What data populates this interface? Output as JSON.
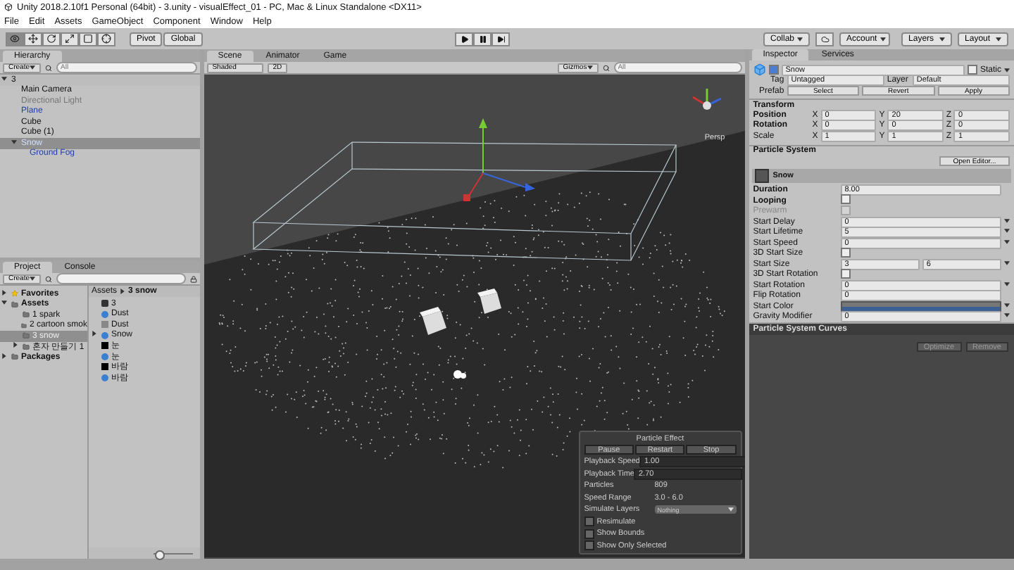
{
  "window": {
    "title": "Unity 2018.2.10f1 Personal (64bit) - 3.unity - visualEffect_01 - PC, Mac & Linux Standalone <DX11>"
  },
  "menu": [
    "File",
    "Edit",
    "Assets",
    "GameObject",
    "Component",
    "Window",
    "Help"
  ],
  "toolbar": {
    "tools": [
      {
        "kind": "view",
        "selected": true
      },
      {
        "kind": "move",
        "selected": false
      },
      {
        "kind": "rotate",
        "selected": false
      },
      {
        "kind": "scale",
        "selected": false
      },
      {
        "kind": "rect",
        "selected": false
      },
      {
        "kind": "transform",
        "selected": false
      }
    ],
    "pivot": "Pivot",
    "global": "Global",
    "collab": "Collab",
    "account": "Account",
    "layers": "Layers",
    "layout": "Layout"
  },
  "hierarchy": {
    "tab": "Hierarchy",
    "create": "Create",
    "placeholder": "All",
    "scene": "3",
    "items": [
      {
        "name": "Main Camera",
        "prefab": false,
        "active": true,
        "selected": false
      },
      {
        "name": "Directional Light",
        "prefab": false,
        "active": false,
        "selected": false
      },
      {
        "name": "Plane",
        "prefab": true,
        "active": true,
        "selected": false
      },
      {
        "name": "Cube",
        "prefab": false,
        "active": true,
        "selected": false
      },
      {
        "name": "Cube (1)",
        "prefab": false,
        "active": true,
        "selected": false
      },
      {
        "name": "Snow",
        "prefab": true,
        "active": true,
        "selected": true,
        "expanded": true,
        "children": [
          {
            "name": "Ground Fog",
            "prefab": true,
            "active": true,
            "selected": false
          }
        ]
      }
    ]
  },
  "project": {
    "tabs": [
      {
        "label": "Project",
        "selected": true
      },
      {
        "label": "Console",
        "selected": false
      }
    ],
    "create": "Create",
    "tree": [
      {
        "name": "Favorites",
        "kind": "favorites",
        "expanded": false,
        "selected": false
      },
      {
        "name": "Assets",
        "kind": "root",
        "expanded": true,
        "selected": false,
        "children": [
          {
            "name": "1 spark",
            "kind": "folder",
            "selected": false
          },
          {
            "name": "2 cartoon smok",
            "kind": "folder",
            "selected": false
          },
          {
            "name": "3 snow",
            "kind": "folder",
            "selected": true
          },
          {
            "name": "혼자 만들기 1",
            "kind": "folder",
            "expanded": false,
            "selected": false
          }
        ]
      },
      {
        "name": "Packages",
        "kind": "root",
        "expanded": false,
        "selected": false
      }
    ],
    "breadcrumb": [
      "Assets",
      "3 snow"
    ],
    "assets": [
      {
        "name": "3",
        "kind": "scene"
      },
      {
        "name": "Dust",
        "kind": "prefab"
      },
      {
        "name": "Dust",
        "kind": "material"
      },
      {
        "name": "Snow",
        "kind": "prefab",
        "expanded": false
      },
      {
        "name": "눈",
        "kind": "texture"
      },
      {
        "name": "눈",
        "kind": "prefab"
      },
      {
        "name": "바람",
        "kind": "texture"
      },
      {
        "name": "바람",
        "kind": "prefab"
      }
    ],
    "icon_size": {
      "level": 0.1
    }
  },
  "scene": {
    "tabs": [
      {
        "label": "Scene",
        "selected": true
      },
      {
        "label": "Animator",
        "selected": false
      },
      {
        "label": "Game",
        "selected": false
      }
    ],
    "shading": "Shaded",
    "mode_2d": "2D",
    "gizmos": "Gizmos",
    "placeholder": "All",
    "view": "Persp",
    "particle_effect": {
      "title": "Particle Effect",
      "buttons": [
        "Pause",
        "Restart",
        "Stop"
      ],
      "fields": [
        {
          "label": "Playback Speed",
          "value": "1.00",
          "kind": "input"
        },
        {
          "label": "Playback Time",
          "value": "2.70",
          "kind": "input"
        },
        {
          "label": "Particles",
          "value": "809",
          "kind": "text"
        },
        {
          "label": "Speed Range",
          "value": "3.0 - 6.0",
          "kind": "text"
        },
        {
          "label": "Simulate Layers",
          "value": "Nothing",
          "kind": "select"
        }
      ],
      "toggles": [
        {
          "label": "Resimulate",
          "checked": false
        },
        {
          "label": "Show Bounds",
          "checked": false
        },
        {
          "label": "Show Only Selected",
          "checked": false
        }
      ]
    }
  },
  "inspector": {
    "tabs": [
      {
        "label": "Inspector",
        "selected": true
      },
      {
        "label": "Services",
        "selected": false
      }
    ],
    "object": {
      "name": "Snow",
      "active": true,
      "static_label": "Static",
      "static": false,
      "tag_label": "Tag",
      "tag": "Untagged",
      "layer_label": "Layer",
      "layer": "Default",
      "prefab_label": "Prefab",
      "prefab_buttons": [
        "Select",
        "Revert",
        "Apply"
      ]
    },
    "transform": {
      "title": "Transform",
      "rows": [
        {
          "label": "Position",
          "values": [
            {
              "axis": "X",
              "value": "0"
            },
            {
              "axis": "Y",
              "value": "20"
            },
            {
              "axis": "Z",
              "value": "0"
            }
          ]
        },
        {
          "label": "Rotation",
          "values": [
            {
              "axis": "X",
              "value": "0"
            },
            {
              "axis": "Y",
              "value": "0"
            },
            {
              "axis": "Z",
              "value": "0"
            }
          ]
        },
        {
          "label": "Scale",
          "values": [
            {
              "axis": "X",
              "value": "1"
            },
            {
              "axis": "Y",
              "value": "1"
            },
            {
              "axis": "Z",
              "value": "1"
            }
          ]
        }
      ]
    },
    "particle_system": {
      "title": "Particle System",
      "open_editor": "Open Editor...",
      "module": "Snow",
      "properties": [
        {
          "label": "Duration",
          "kind": "value",
          "value": "8.00",
          "bold": true,
          "disabled": false,
          "menu": false
        },
        {
          "label": "Looping",
          "kind": "check",
          "checked": false,
          "bold": true,
          "disabled": false,
          "menu": false
        },
        {
          "label": "Prewarm",
          "kind": "check",
          "checked": false,
          "bold": false,
          "disabled": true,
          "menu": false
        },
        {
          "label": "Start Delay",
          "kind": "value",
          "value": "0",
          "bold": false,
          "disabled": false,
          "menu": true
        },
        {
          "label": "Start Lifetime",
          "kind": "value",
          "value": "5",
          "bold": false,
          "disabled": false,
          "menu": true
        },
        {
          "label": "Start Speed",
          "kind": "value",
          "value": "0",
          "bold": false,
          "disabled": false,
          "menu": true
        },
        {
          "label": "3D Start Size",
          "kind": "check",
          "checked": false,
          "bold": false,
          "disabled": false,
          "menu": false
        },
        {
          "label": "Start Size",
          "kind": "range",
          "value": "3",
          "value2": "6",
          "bold": false,
          "disabled": false,
          "menu": true
        },
        {
          "label": "3D Start Rotation",
          "kind": "check",
          "checked": false,
          "bold": false,
          "disabled": false,
          "menu": false
        },
        {
          "label": "Start Rotation",
          "kind": "value",
          "value": "0",
          "bold": false,
          "disabled": false,
          "menu": true
        },
        {
          "label": "Flip Rotation",
          "kind": "value",
          "value": "0",
          "bold": false,
          "disabled": false,
          "menu": false
        },
        {
          "label": "Start Color",
          "kind": "gradient",
          "bold": false,
          "disabled": false,
          "menu": true
        },
        {
          "label": "Gravity Modifier",
          "kind": "value",
          "value": "0",
          "bold": false,
          "disabled": false,
          "menu": true
        }
      ]
    }
  },
  "curves": {
    "title": "Particle System Curves",
    "buttons": [
      "Optimize",
      "Remove"
    ]
  }
}
